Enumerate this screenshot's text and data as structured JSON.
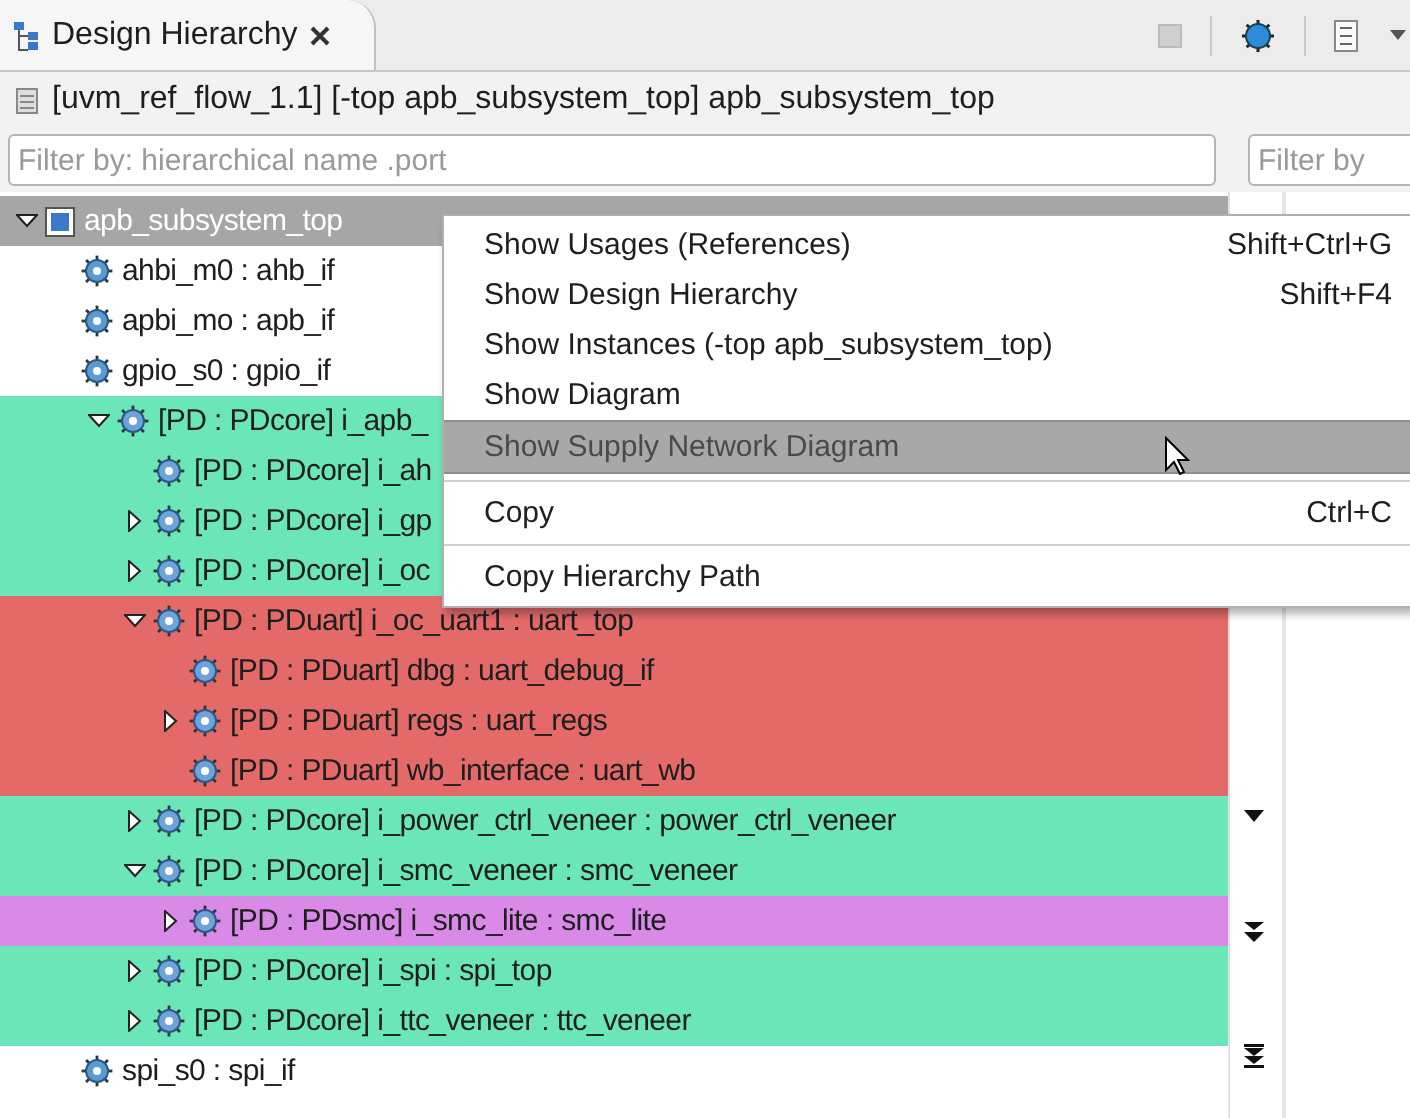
{
  "tab": {
    "title": "Design Hierarchy",
    "selected": true
  },
  "breadcrumb": "[uvm_ref_flow_1.1] [-top apb_subsystem_top] apb_subsystem_top",
  "filters": [
    {
      "placeholder": "Filter by: hierarchical name .port"
    },
    {
      "placeholder": "Filter by"
    }
  ],
  "tree": [
    {
      "label": "apb_subsystem_top",
      "kind": "top",
      "selected": true,
      "expanded": true,
      "children": [
        {
          "label": "ahbi_m0 : ahb_if",
          "kind": "interface",
          "selected": false
        },
        {
          "label": "apbi_mo : apb_if",
          "kind": "interface",
          "selected": false
        },
        {
          "label": "gpio_s0 : gpio_if",
          "kind": "interface",
          "selected": false
        },
        {
          "label": "[PD : PDcore] i_apb_",
          "kind": "instance",
          "selected": false,
          "color": "#6be6b8",
          "expanded": true,
          "children": [
            {
              "label": "[PD : PDcore] i_ah",
              "kind": "instance",
              "selected": false,
              "color": "#6be6b8"
            },
            {
              "label": "[PD : PDcore] i_gp",
              "kind": "instance",
              "selected": false,
              "color": "#6be6b8",
              "expanded": false
            },
            {
              "label": "[PD : PDcore] i_oc",
              "kind": "instance",
              "selected": false,
              "color": "#6be6b8",
              "expanded": false
            },
            {
              "label": "[PD : PDuart] i_oc_uart1 : uart_top",
              "kind": "instance",
              "selected": false,
              "color": "#e46a6a",
              "expanded": true,
              "children": [
                {
                  "label": "[PD : PDuart] dbg : uart_debug_if",
                  "kind": "instance",
                  "selected": false,
                  "color": "#e46a6a"
                },
                {
                  "label": "[PD : PDuart] regs : uart_regs",
                  "kind": "instance",
                  "selected": false,
                  "color": "#e46a6a",
                  "expanded": false
                },
                {
                  "label": "[PD : PDuart] wb_interface : uart_wb",
                  "kind": "instance",
                  "selected": false,
                  "color": "#e46a6a"
                }
              ]
            },
            {
              "label": "[PD : PDcore] i_power_ctrl_veneer : power_ctrl_veneer",
              "kind": "instance",
              "selected": false,
              "color": "#6be6b8",
              "expanded": false
            },
            {
              "label": "[PD : PDcore] i_smc_veneer : smc_veneer",
              "kind": "instance",
              "selected": false,
              "color": "#6be6b8",
              "expanded": true,
              "children": [
                {
                  "label": "[PD : PDsmc] i_smc_lite : smc_lite",
                  "kind": "instance",
                  "selected": false,
                  "color": "#d88ae6",
                  "expanded": false
                }
              ]
            },
            {
              "label": "[PD : PDcore] i_spi : spi_top",
              "kind": "instance",
              "selected": false,
              "color": "#6be6b8",
              "expanded": false
            },
            {
              "label": "[PD : PDcore] i_ttc_veneer : ttc_veneer",
              "kind": "instance",
              "selected": false,
              "color": "#6be6b8",
              "expanded": false
            }
          ]
        },
        {
          "label": "spi_s0 : spi_if",
          "kind": "interface",
          "selected": false
        }
      ]
    }
  ],
  "context_menu": [
    {
      "kind": "item",
      "label": "Show Usages (References)",
      "shortcut": "Shift+Ctrl+G",
      "selected": false
    },
    {
      "kind": "item",
      "label": "Show Design Hierarchy",
      "shortcut": "Shift+F4",
      "selected": false
    },
    {
      "kind": "item",
      "label": "Show Instances (-top apb_subsystem_top)",
      "selected": false
    },
    {
      "kind": "item",
      "label": "Show Diagram",
      "selected": false
    },
    {
      "kind": "item",
      "label": "Show Supply Network Diagram",
      "selected": true
    },
    {
      "kind": "separator"
    },
    {
      "kind": "item",
      "label": "Copy",
      "shortcut": "Ctrl+C",
      "selected": false
    },
    {
      "kind": "separator"
    },
    {
      "kind": "item",
      "label": "Copy Hierarchy Path",
      "selected": false
    }
  ]
}
